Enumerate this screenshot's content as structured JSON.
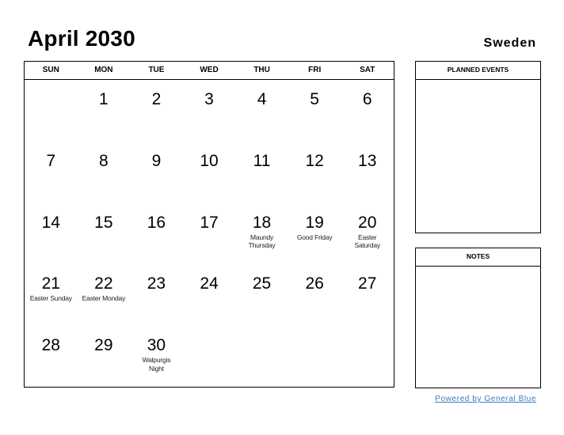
{
  "header": {
    "title": "April 2030",
    "country": "Sweden"
  },
  "calendar": {
    "weekdays": [
      "SUN",
      "MON",
      "TUE",
      "WED",
      "THU",
      "FRI",
      "SAT"
    ],
    "cells": [
      {
        "day": "",
        "holiday": ""
      },
      {
        "day": "1",
        "holiday": ""
      },
      {
        "day": "2",
        "holiday": ""
      },
      {
        "day": "3",
        "holiday": ""
      },
      {
        "day": "4",
        "holiday": ""
      },
      {
        "day": "5",
        "holiday": ""
      },
      {
        "day": "6",
        "holiday": ""
      },
      {
        "day": "7",
        "holiday": ""
      },
      {
        "day": "8",
        "holiday": ""
      },
      {
        "day": "9",
        "holiday": ""
      },
      {
        "day": "10",
        "holiday": ""
      },
      {
        "day": "11",
        "holiday": ""
      },
      {
        "day": "12",
        "holiday": ""
      },
      {
        "day": "13",
        "holiday": ""
      },
      {
        "day": "14",
        "holiday": ""
      },
      {
        "day": "15",
        "holiday": ""
      },
      {
        "day": "16",
        "holiday": ""
      },
      {
        "day": "17",
        "holiday": ""
      },
      {
        "day": "18",
        "holiday": "Maundy Thursday"
      },
      {
        "day": "19",
        "holiday": "Good Friday"
      },
      {
        "day": "20",
        "holiday": "Easter Saturday"
      },
      {
        "day": "21",
        "holiday": "Easter Sunday"
      },
      {
        "day": "22",
        "holiday": "Easter Monday"
      },
      {
        "day": "23",
        "holiday": ""
      },
      {
        "day": "24",
        "holiday": ""
      },
      {
        "day": "25",
        "holiday": ""
      },
      {
        "day": "26",
        "holiday": ""
      },
      {
        "day": "27",
        "holiday": ""
      },
      {
        "day": "28",
        "holiday": ""
      },
      {
        "day": "29",
        "holiday": ""
      },
      {
        "day": "30",
        "holiday": "Walpurgis Night"
      },
      {
        "day": "",
        "holiday": ""
      },
      {
        "day": "",
        "holiday": ""
      },
      {
        "day": "",
        "holiday": ""
      },
      {
        "day": "",
        "holiday": ""
      }
    ]
  },
  "side": {
    "planned_events_label": "PLANNED EVENTS",
    "notes_label": "NOTES"
  },
  "footer": {
    "powered_by": "Powered by General Blue",
    "link_color": "#3a7bbf"
  }
}
